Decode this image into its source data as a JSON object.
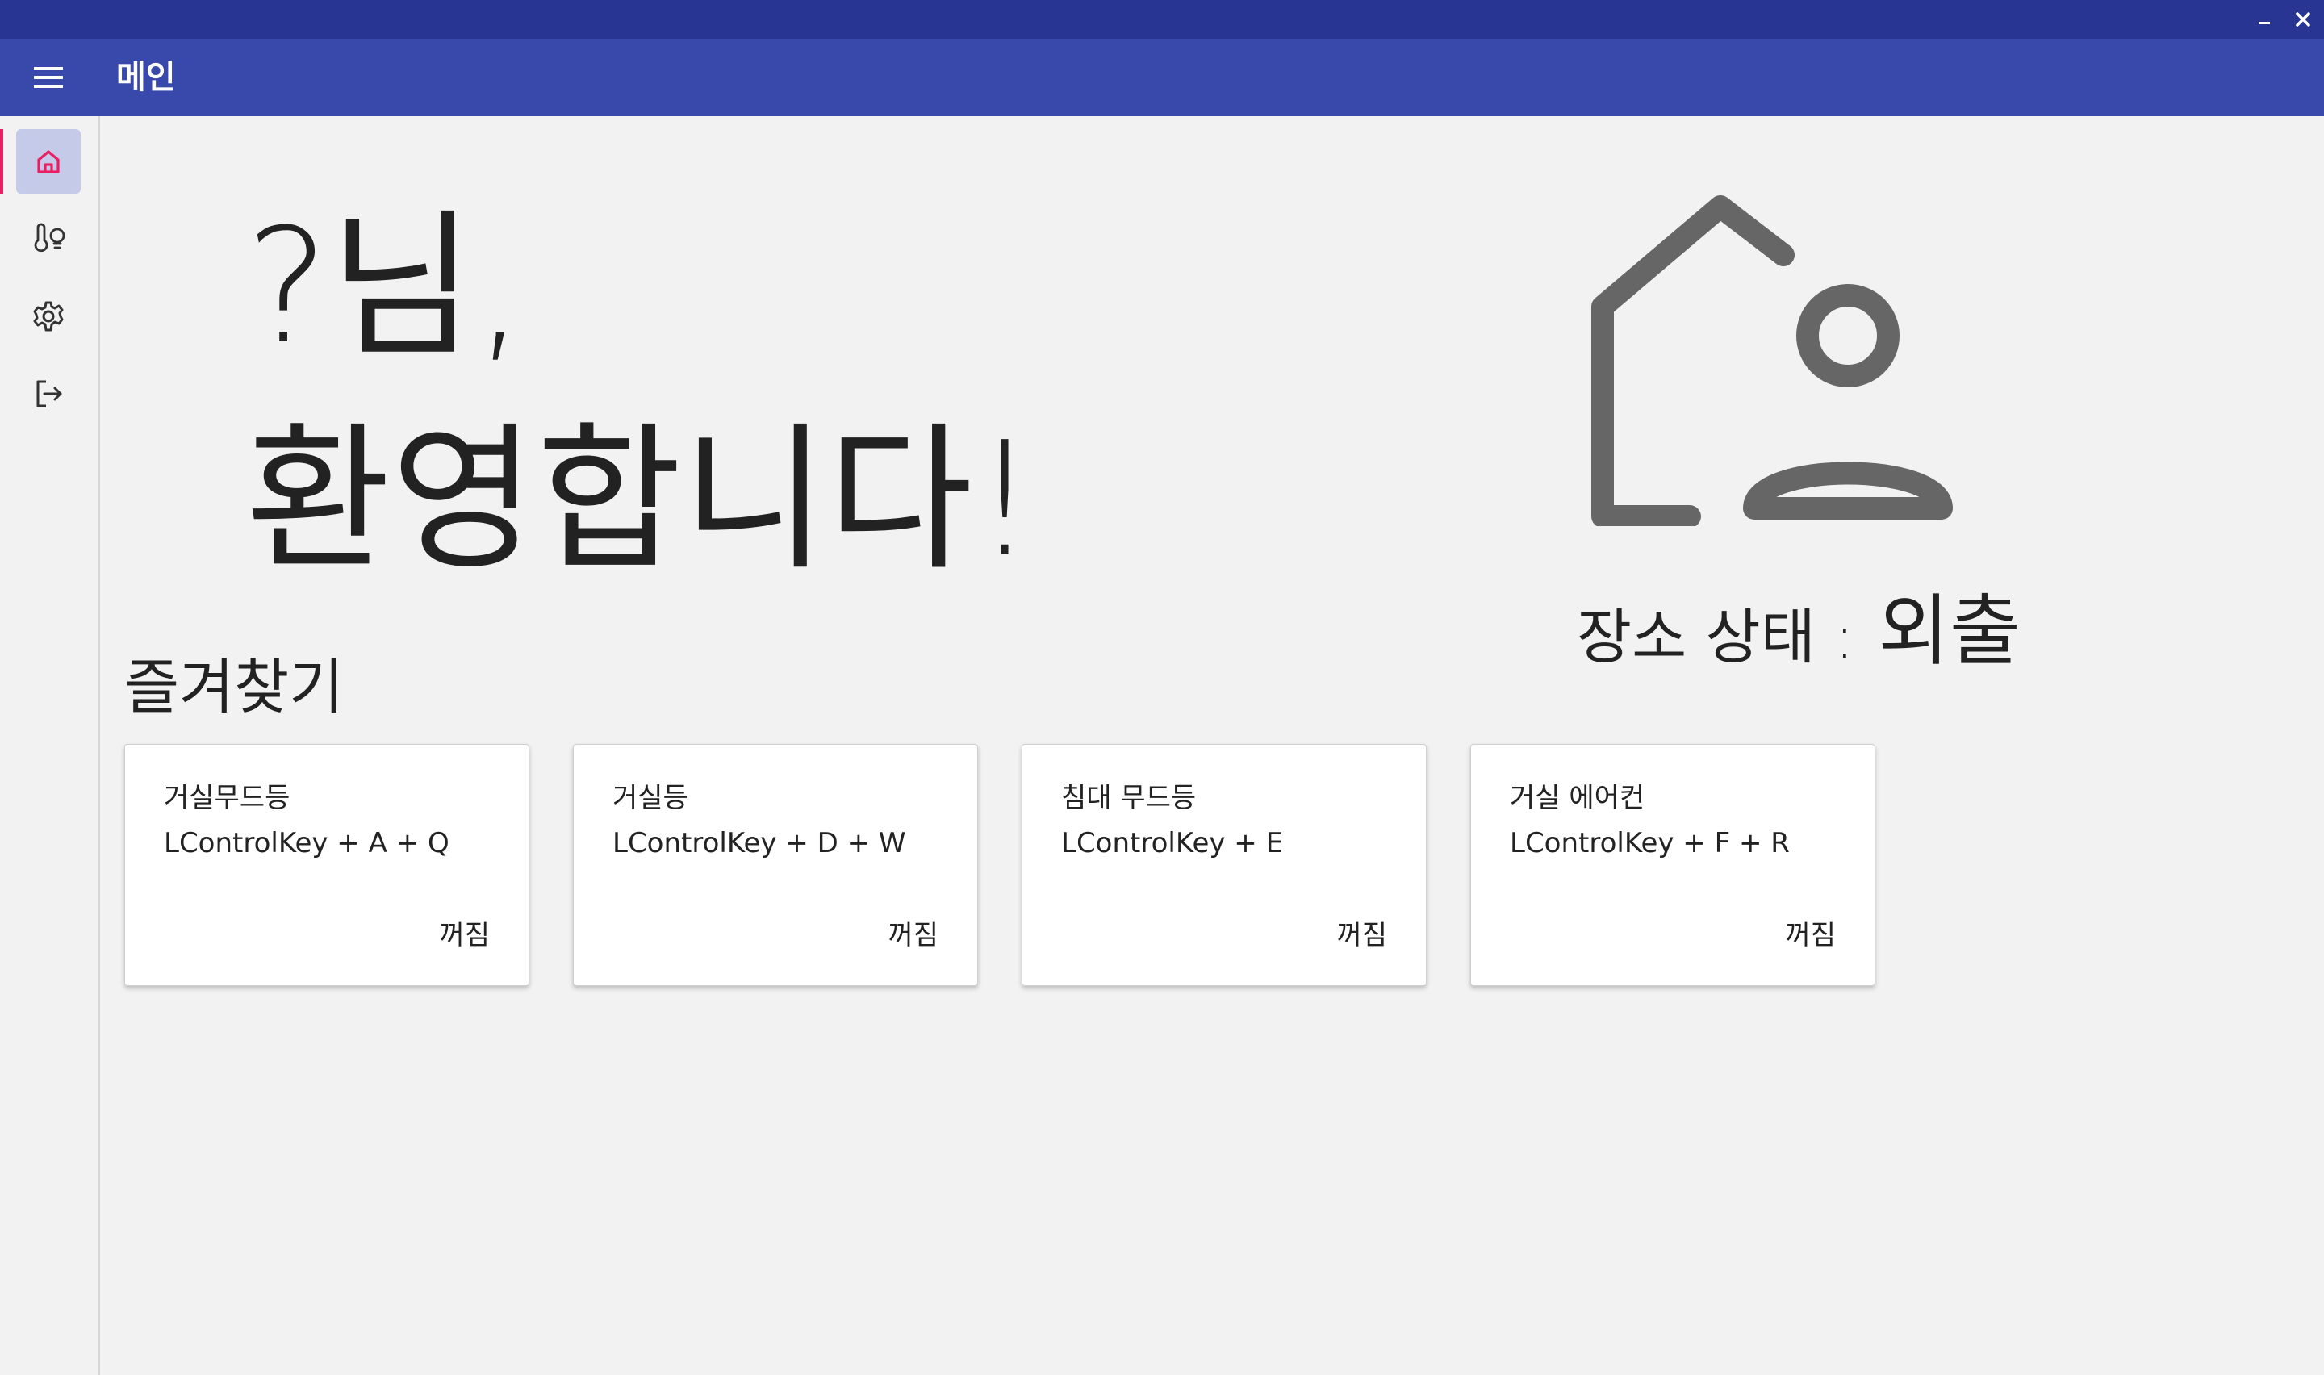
{
  "window": {
    "minimize_icon": "minimize-icon",
    "close_icon": "close-icon"
  },
  "appbar": {
    "title": "메인",
    "menu_icon": "hamburger-menu-icon",
    "background": "#3949ab"
  },
  "sidebar": {
    "items": [
      {
        "name": "home",
        "icon": "home-icon",
        "active": true
      },
      {
        "name": "devices",
        "icon": "thermometer-bulb-icon",
        "active": false
      },
      {
        "name": "settings",
        "icon": "gear-icon",
        "active": false
      },
      {
        "name": "logout",
        "icon": "logout-icon",
        "active": false
      }
    ],
    "active_color": "#e91e63"
  },
  "welcome": {
    "line1": "?님,",
    "line2": "환영합니다!"
  },
  "status": {
    "icon": "home-person-icon",
    "label": "장소 상태 :",
    "value": "외출"
  },
  "favorites": {
    "title": "즐겨찾기",
    "cards": [
      {
        "name": "거실무드등",
        "shortcut": "LControlKey + A + Q",
        "state": "꺼짐"
      },
      {
        "name": "거실등",
        "shortcut": "LControlKey + D + W",
        "state": "꺼짐"
      },
      {
        "name": "침대 무드등",
        "shortcut": "LControlKey + E",
        "state": "꺼짐"
      },
      {
        "name": "거실 에어컨",
        "shortcut": "LControlKey + F + R",
        "state": "꺼짐"
      }
    ]
  }
}
